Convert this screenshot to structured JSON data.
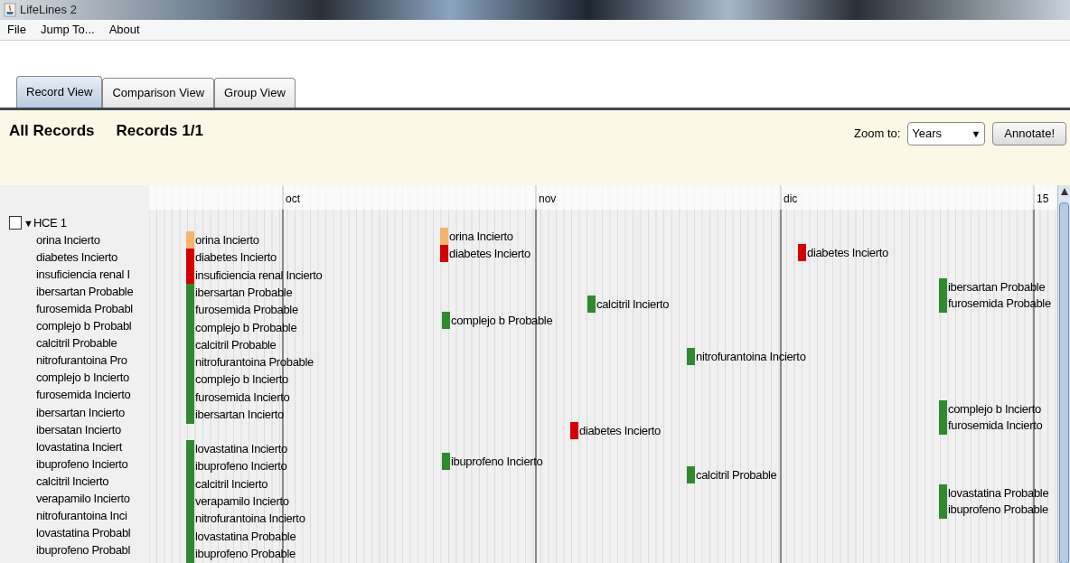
{
  "window": {
    "title": "LifeLines 2"
  },
  "menu": [
    "File",
    "Jump To...",
    "About"
  ],
  "tabs": [
    {
      "label": "Record View",
      "selected": true
    },
    {
      "label": "Comparison View",
      "selected": false
    },
    {
      "label": "Group View",
      "selected": false
    }
  ],
  "header": {
    "title": "All Records",
    "records": "Records 1/1",
    "zoom_label": "Zoom to:",
    "zoom_value": "Years",
    "zoom_arrow": "▼",
    "annotate_button": "Annotate!"
  },
  "axis_labels": [
    "oct",
    "nov",
    "dic",
    "15"
  ],
  "record": {
    "label": "HCE 1",
    "toggle": "▼",
    "expanded": true,
    "checked": false,
    "items": [
      "orina Incierto",
      "diabetes Incierto",
      "insuficiencia renal I",
      "ibersartan Probable",
      "furosemida Probabl",
      "complejo b Probabl",
      "calcitril Probable",
      "nitrofurantoina Pro",
      "complejo b Incierto",
      "furosemida Incierto",
      "ibersartan Incierto",
      "ibersatan Incierto",
      "lovastatina  Inciert",
      "ibuprofeno Incierto",
      "calcitril Incierto",
      "verapamilo  Incierto",
      "nitrofurantoina Inci",
      "lovastatina  Probabl",
      "ibuprofeno Probabl"
    ]
  },
  "event_clusters": [
    {
      "events": [
        {
          "label": "orina Incierto",
          "color": "#f5b56a"
        },
        {
          "label": "diabetes Incierto",
          "color": "#d40000"
        },
        {
          "label": "insuficiencia renal  Incierto",
          "color": "#d40000"
        },
        {
          "label": "ibersartan Probable",
          "color": "#2e8b2e"
        },
        {
          "label": "furosemida Probable",
          "color": "#2e8b2e"
        },
        {
          "label": "complejo b Probable",
          "color": "#2e8b2e"
        },
        {
          "label": "calcitril Probable",
          "color": "#2e8b2e"
        },
        {
          "label": "nitrofurantoina Probable",
          "color": "#2e8b2e"
        },
        {
          "label": "complejo b Incierto",
          "color": "#2e8b2e"
        },
        {
          "label": "furosemida Incierto",
          "color": "#2e8b2e"
        },
        {
          "label": "ibersartan Incierto",
          "color": "#2e8b2e"
        }
      ]
    },
    {
      "events": [
        {
          "label": "lovastatina  Incierto",
          "color": "#2e8b2e"
        },
        {
          "label": "ibuprofeno Incierto",
          "color": "#2e8b2e"
        },
        {
          "label": "calcitril Incierto",
          "color": "#2e8b2e"
        },
        {
          "label": "verapamilo  Incierto",
          "color": "#2e8b2e"
        },
        {
          "label": "nitrofurantoina Incierto",
          "color": "#2e8b2e"
        },
        {
          "label": "lovastatina  Probable",
          "color": "#2e8b2e"
        },
        {
          "label": "ibuprofeno Probable",
          "color": "#2e8b2e"
        }
      ]
    },
    {
      "events": [
        {
          "label": "orina Incierto",
          "color": "#f5b56a"
        },
        {
          "label": "diabetes Incierto",
          "color": "#d40000"
        }
      ]
    },
    {
      "events": [
        {
          "label": "complejo b Probable",
          "color": "#2e8b2e"
        }
      ]
    },
    {
      "events": [
        {
          "label": "ibuprofeno Incierto",
          "color": "#2e8b2e"
        }
      ]
    },
    {
      "events": [
        {
          "label": "calcitril Incierto",
          "color": "#2e8b2e"
        }
      ]
    },
    {
      "events": [
        {
          "label": "diabetes Incierto",
          "color": "#d40000"
        }
      ]
    },
    {
      "events": [
        {
          "label": "nitrofurantoina Incierto",
          "color": "#2e8b2e"
        }
      ]
    },
    {
      "events": [
        {
          "label": "calcitril Probable",
          "color": "#2e8b2e"
        }
      ]
    },
    {
      "events": [
        {
          "label": "diabetes Incierto",
          "color": "#d40000"
        }
      ]
    },
    {
      "events": [
        {
          "label": "ibersartan Probable",
          "color": "#2e8b2e"
        },
        {
          "label": "furosemida Probable",
          "color": "#2e8b2e"
        }
      ]
    },
    {
      "events": [
        {
          "label": "complejo b Incierto",
          "color": "#2e8b2e"
        },
        {
          "label": "furosemida Incierto",
          "color": "#2e8b2e"
        }
      ]
    },
    {
      "events": [
        {
          "label": "lovastatina  Probable",
          "color": "#2e8b2e"
        },
        {
          "label": "ibuprofeno Probable",
          "color": "#2e8b2e"
        }
      ]
    }
  ]
}
